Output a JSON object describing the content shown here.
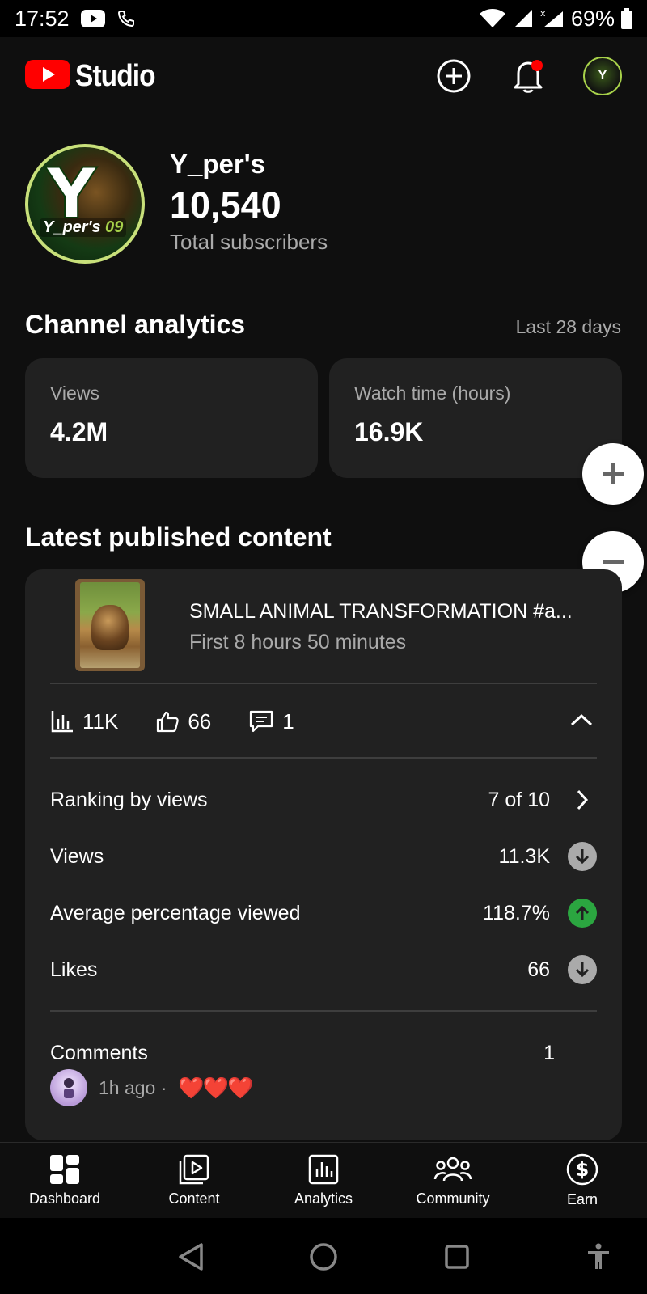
{
  "status_bar": {
    "time": "17:52",
    "battery": "69%"
  },
  "header": {
    "logo_text": "Studio"
  },
  "channel": {
    "name": "Y_per's",
    "subscriber_count": "10,540",
    "subscriber_label": "Total subscribers",
    "avatar_letter": "Y",
    "avatar_text": "Y_per's",
    "avatar_number": "09"
  },
  "analytics": {
    "title": "Channel analytics",
    "period": "Last 28 days",
    "cards": [
      {
        "label": "Views",
        "value": "4.2M"
      },
      {
        "label": "Watch time (hours)",
        "value": "16.9K"
      }
    ]
  },
  "latest": {
    "title": "Latest published content",
    "video": {
      "title": "SMALL ANIMAL TRANSFORMATION #a...",
      "subtitle": "First 8 hours 50 minutes"
    },
    "metrics": {
      "views": "11K",
      "likes": "66",
      "comments": "1"
    },
    "rows": [
      {
        "label": "Ranking by views",
        "value": "7 of 10"
      },
      {
        "label": "Views",
        "value": "11.3K"
      },
      {
        "label": "Average percentage viewed",
        "value": "118.7%"
      },
      {
        "label": "Likes",
        "value": "66"
      }
    ],
    "comments_label": "Comments",
    "comments_value": "1",
    "comment": {
      "time": "1h ago ·",
      "text": "❤️❤️❤️"
    }
  },
  "bottom_nav": [
    {
      "label": "Dashboard",
      "icon": "dashboard-icon"
    },
    {
      "label": "Content",
      "icon": "content-icon"
    },
    {
      "label": "Analytics",
      "icon": "analytics-icon"
    },
    {
      "label": "Community",
      "icon": "community-icon"
    },
    {
      "label": "Earn",
      "icon": "earn-icon"
    }
  ],
  "colors": {
    "brand_red": "#ff0000",
    "up_green": "#2ba640",
    "card_bg": "#212121",
    "bg": "#0f0f0f"
  }
}
